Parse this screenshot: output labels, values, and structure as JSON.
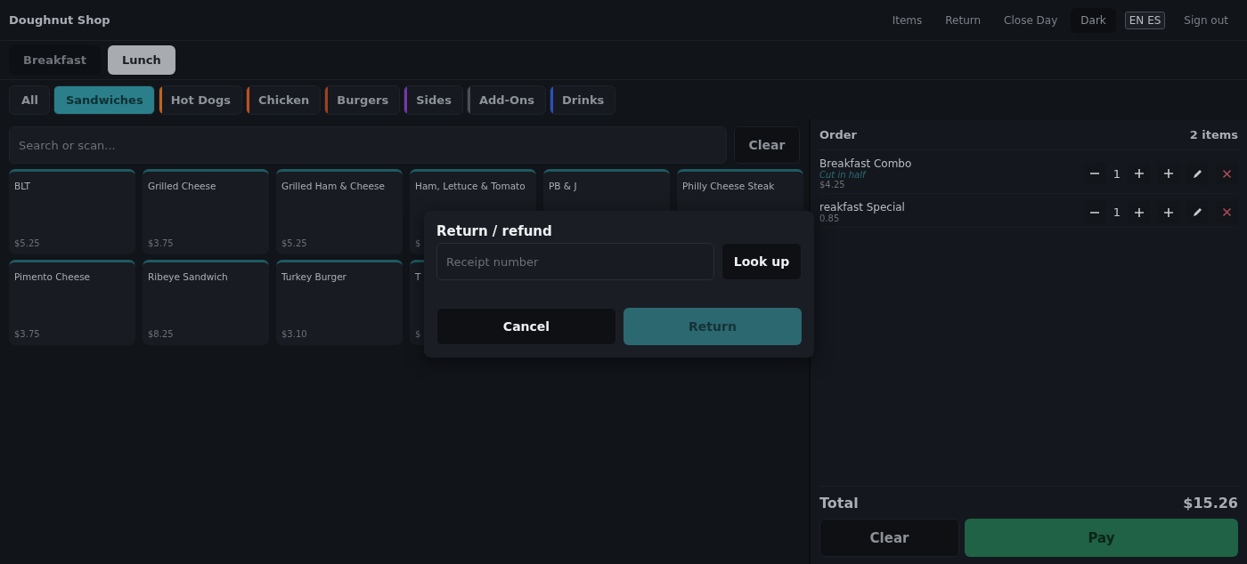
{
  "app": {
    "title": "Doughnut Shop"
  },
  "nav": [
    {
      "label": "Items",
      "kind": "link"
    },
    {
      "label": "Return",
      "kind": "link"
    },
    {
      "label": "Close Day",
      "kind": "link"
    },
    {
      "label": "Dark",
      "kind": "toggle"
    },
    {
      "label": "EN ES",
      "kind": "lang"
    },
    {
      "label": "Sign out",
      "kind": "link"
    }
  ],
  "meals": [
    {
      "label": "Breakfast",
      "selected": false
    },
    {
      "label": "Lunch",
      "selected": true
    }
  ],
  "categories": [
    {
      "label": "All",
      "selected": false
    },
    {
      "label": "Sandwiches",
      "selected": true,
      "color": "#2a7f8a"
    },
    {
      "label": "Hot Dogs",
      "selected": false,
      "color": "#c0641e"
    },
    {
      "label": "Chicken",
      "selected": false,
      "color": "#c0501e"
    },
    {
      "label": "Burgers",
      "selected": false,
      "color": "#a0401e"
    },
    {
      "label": "Sides",
      "selected": false,
      "color": "#7a35b0"
    },
    {
      "label": "Add-Ons",
      "selected": false,
      "color": "#4a4f58"
    },
    {
      "label": "Drinks",
      "selected": false,
      "color": "#2a4fc0"
    }
  ],
  "search": {
    "placeholder": "Search or scan...",
    "clear": "Clear"
  },
  "products": [
    {
      "name": "BLT",
      "price": "$5.25"
    },
    {
      "name": "Grilled Cheese",
      "price": "$3.75"
    },
    {
      "name": "Grilled Ham & Cheese",
      "price": "$5.25"
    },
    {
      "name": "Ham, Lettuce & Tomato",
      "price": "$"
    },
    {
      "name": "PB & J"
    },
    {
      "name": "Philly Cheese Steak"
    },
    {
      "name": "Pimento Cheese",
      "price": "$3.75"
    },
    {
      "name": "Ribeye Sandwich",
      "price": "$8.25"
    },
    {
      "name": "Turkey Burger",
      "price": "$3.10"
    },
    {
      "name": "T",
      "price": "$"
    }
  ],
  "order": {
    "title": "Order",
    "count": "2 items",
    "items": [
      {
        "name": "Breakfast Combo",
        "note": "Cut in half",
        "price": "$4.25",
        "qty": "1"
      },
      {
        "name": "reakfast Special",
        "price": "0.85",
        "qty": "1"
      }
    ],
    "total_label": "Total",
    "total": "$15.26",
    "clear": "Clear",
    "pay": "Pay"
  },
  "dialog": {
    "title": "Return / refund",
    "placeholder": "Receipt number",
    "lookup": "Look up",
    "cancel": "Cancel",
    "confirm": "Return"
  }
}
